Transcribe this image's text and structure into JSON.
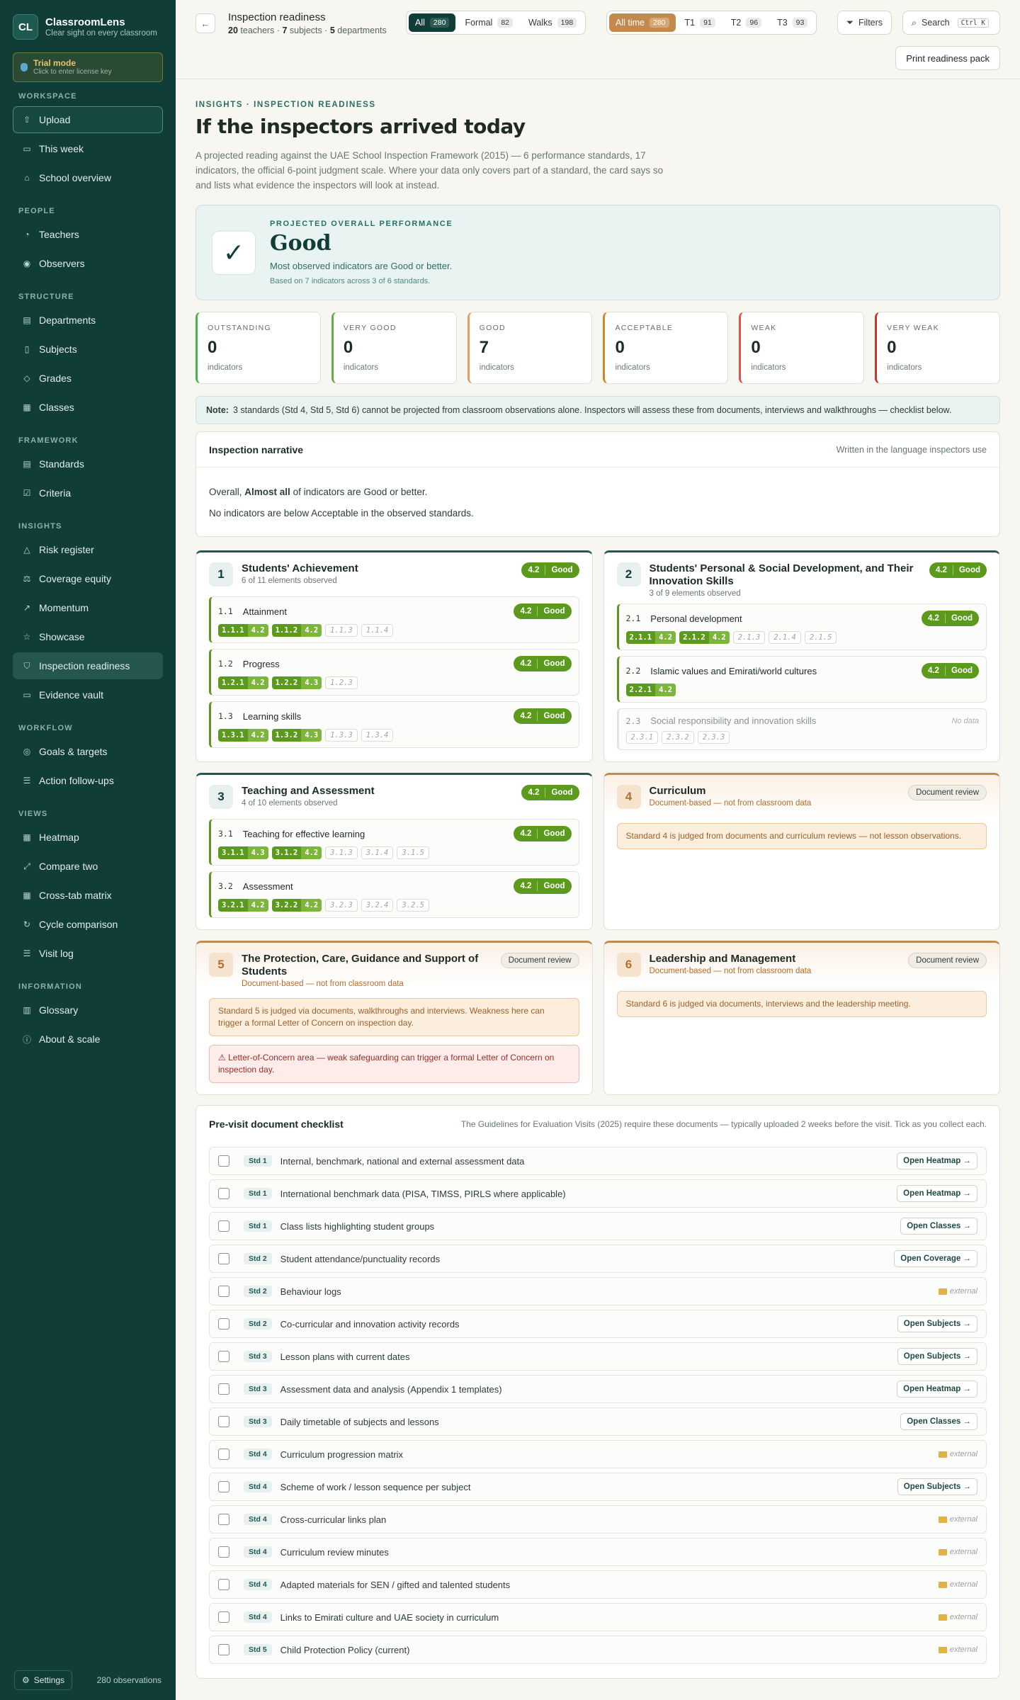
{
  "app": {
    "logo": "CL",
    "name": "ClassroomLens",
    "tagline": "Clear sight on every classroom"
  },
  "trial": {
    "title": "Trial mode",
    "subtitle": "Click to enter license key"
  },
  "sidebar": {
    "sections": [
      {
        "label": "WORKSPACE",
        "items": [
          {
            "label": "Upload",
            "icon": "upload-icon",
            "glyph": "⇧"
          },
          {
            "label": "This week",
            "icon": "calendar-icon",
            "glyph": "▭"
          },
          {
            "label": "School overview",
            "icon": "school-icon",
            "glyph": "⌂"
          }
        ]
      },
      {
        "label": "PEOPLE",
        "items": [
          {
            "label": "Teachers",
            "icon": "user-icon",
            "glyph": "◔"
          },
          {
            "label": "Observers",
            "icon": "eye-icon",
            "glyph": "◉"
          }
        ]
      },
      {
        "label": "STRUCTURE",
        "items": [
          {
            "label": "Departments",
            "icon": "layers-icon",
            "glyph": "▤"
          },
          {
            "label": "Subjects",
            "icon": "book-icon",
            "glyph": "▯"
          },
          {
            "label": "Grades",
            "icon": "graduation-cap-icon",
            "glyph": "◇"
          },
          {
            "label": "Classes",
            "icon": "grid-icon",
            "glyph": "▦"
          }
        ]
      },
      {
        "label": "FRAMEWORK",
        "items": [
          {
            "label": "Standards",
            "icon": "document-icon",
            "glyph": "▤"
          },
          {
            "label": "Criteria",
            "icon": "checklist-icon",
            "glyph": "☑"
          }
        ]
      },
      {
        "label": "INSIGHTS",
        "items": [
          {
            "label": "Risk register",
            "icon": "warning-icon",
            "glyph": "△"
          },
          {
            "label": "Coverage equity",
            "icon": "scale-icon",
            "glyph": "⚖"
          },
          {
            "label": "Momentum",
            "icon": "trend-icon",
            "glyph": "↗"
          },
          {
            "label": "Showcase",
            "icon": "star-icon",
            "glyph": "☆"
          },
          {
            "label": "Inspection readiness",
            "icon": "shield-icon",
            "glyph": "⛉"
          },
          {
            "label": "Evidence vault",
            "icon": "folder-icon",
            "glyph": "▭"
          }
        ]
      },
      {
        "label": "WORKFLOW",
        "items": [
          {
            "label": "Goals & targets",
            "icon": "target-icon",
            "glyph": "◎"
          },
          {
            "label": "Action follow-ups",
            "icon": "list-check-icon",
            "glyph": "☰"
          }
        ]
      },
      {
        "label": "VIEWS",
        "items": [
          {
            "label": "Heatmap",
            "icon": "heatmap-icon",
            "glyph": "▦"
          },
          {
            "label": "Compare two",
            "icon": "compare-icon",
            "glyph": "⤢"
          },
          {
            "label": "Cross-tab matrix",
            "icon": "table-icon",
            "glyph": "▦"
          },
          {
            "label": "Cycle comparison",
            "icon": "refresh-icon",
            "glyph": "↻"
          },
          {
            "label": "Visit log",
            "icon": "list-icon",
            "glyph": "☰"
          }
        ]
      },
      {
        "label": "INFORMATION",
        "items": [
          {
            "label": "Glossary",
            "icon": "book-open-icon",
            "glyph": "▥"
          },
          {
            "label": "About & scale",
            "icon": "info-icon",
            "glyph": "ⓘ"
          }
        ]
      }
    ],
    "active": "Inspection readiness",
    "footer": {
      "settings": "Settings",
      "observations": "280 observations"
    }
  },
  "header": {
    "title": "Inspection readiness",
    "teachers": "20",
    "teachers_label": "teachers",
    "subjects": "7",
    "subjects_label": "subjects",
    "departments": "5",
    "departments_label": "departments",
    "type_filter": [
      {
        "label": "All",
        "count": "280",
        "selected": true
      },
      {
        "label": "Formal",
        "count": "82"
      },
      {
        "label": "Walks",
        "count": "198"
      }
    ],
    "term_filter": [
      {
        "label": "All time",
        "count": "280",
        "selected": true
      },
      {
        "label": "T1",
        "count": "91"
      },
      {
        "label": "T2",
        "count": "96"
      },
      {
        "label": "T3",
        "count": "93"
      }
    ],
    "filters_label": "Filters",
    "search_label": "Search",
    "search_shortcut": "Ctrl K",
    "print_label": "Print readiness pack"
  },
  "intro": {
    "eyebrow": "INSIGHTS · INSPECTION READINESS",
    "title": "If the inspectors arrived today",
    "lead": "A projected reading against the UAE School Inspection Framework (2015) — 6 performance standards, 17 indicators, the official 6-point judgment scale. Where your data only covers part of a standard, the card says so and lists what evidence the inspectors will look at instead."
  },
  "overall": {
    "eyebrow": "PROJECTED OVERALL PERFORMANCE",
    "judgment": "Good",
    "description": "Most observed indicators are Good or better.",
    "basis": "Based on 7 indicators across 3 of 6 standards."
  },
  "distribution": [
    {
      "label": "OUTSTANDING",
      "count": "0",
      "unit": "indicators",
      "color": "#4caf50"
    },
    {
      "label": "VERY GOOD",
      "count": "0",
      "unit": "indicators",
      "color": "#6aa84f"
    },
    {
      "label": "GOOD",
      "count": "7",
      "unit": "indicators",
      "color": "#d9a36b"
    },
    {
      "label": "ACCEPTABLE",
      "count": "0",
      "unit": "indicators",
      "color": "#d9822b"
    },
    {
      "label": "WEAK",
      "count": "0",
      "unit": "indicators",
      "color": "#e0524a"
    },
    {
      "label": "VERY WEAK",
      "count": "0",
      "unit": "indicators",
      "color": "#c0392b"
    }
  ],
  "note": {
    "label": "Note:",
    "text": "3 standards (Std 4, Std 5, Std 6) cannot be projected from classroom observations alone. Inspectors will assess these from documents, interviews and walkthroughs — checklist below."
  },
  "narrative": {
    "title": "Inspection narrative",
    "caption": "Written in the language inspectors use",
    "line1_pre": "Overall,",
    "line1_bold": "Almost all",
    "line1_post": "of indicators are Good or better.",
    "line2": "No indicators are below Acceptable in the observed standards."
  },
  "standards_row1": [
    {
      "num": "1",
      "title": "Students' Achievement",
      "sub": "6 of 11 elements observed",
      "score": "4.2",
      "judgment": "Good",
      "indicators": [
        {
          "code": "1.1",
          "name": "Attainment",
          "score": "4.2",
          "judgment": "Good",
          "elements": [
            {
              "code": "1.1.1",
              "v": "4.2"
            },
            {
              "code": "1.1.2",
              "v": "4.2"
            },
            {
              "code": "1.1.3"
            },
            {
              "code": "1.1.4"
            }
          ]
        },
        {
          "code": "1.2",
          "name": "Progress",
          "score": "4.2",
          "judgment": "Good",
          "elements": [
            {
              "code": "1.2.1",
              "v": "4.2"
            },
            {
              "code": "1.2.2",
              "v": "4.3"
            },
            {
              "code": "1.2.3"
            }
          ]
        },
        {
          "code": "1.3",
          "name": "Learning skills",
          "score": "4.2",
          "judgment": "Good",
          "elements": [
            {
              "code": "1.3.1",
              "v": "4.2"
            },
            {
              "code": "1.3.2",
              "v": "4.3"
            },
            {
              "code": "1.3.3"
            },
            {
              "code": "1.3.4"
            }
          ]
        }
      ]
    },
    {
      "num": "2",
      "title": "Students' Personal & Social Development, and Their Innovation Skills",
      "sub": "3 of 9 elements observed",
      "score": "4.2",
      "judgment": "Good",
      "indicators": [
        {
          "code": "2.1",
          "name": "Personal development",
          "score": "4.2",
          "judgment": "Good",
          "elements": [
            {
              "code": "2.1.1",
              "v": "4.2"
            },
            {
              "code": "2.1.2",
              "v": "4.2"
            },
            {
              "code": "2.1.3"
            },
            {
              "code": "2.1.4"
            },
            {
              "code": "2.1.5"
            }
          ]
        },
        {
          "code": "2.2",
          "name": "Islamic values and Emirati/world cultures",
          "score": "4.2",
          "judgment": "Good",
          "elements": [
            {
              "code": "2.2.1",
              "v": "4.2"
            }
          ]
        },
        {
          "code": "2.3",
          "name": "Social responsibility and innovation skills",
          "nodata": "No data",
          "elements": [
            {
              "code": "2.3.1"
            },
            {
              "code": "2.3.2"
            },
            {
              "code": "2.3.3"
            }
          ]
        }
      ]
    }
  ],
  "standards_row2_obs": {
    "num": "3",
    "title": "Teaching and Assessment",
    "sub": "4 of 10 elements observed",
    "score": "4.2",
    "judgment": "Good",
    "indicators": [
      {
        "code": "3.1",
        "name": "Teaching for effective learning",
        "score": "4.2",
        "judgment": "Good",
        "elements": [
          {
            "code": "3.1.1",
            "v": "4.3"
          },
          {
            "code": "3.1.2",
            "v": "4.2"
          },
          {
            "code": "3.1.3"
          },
          {
            "code": "3.1.4"
          },
          {
            "code": "3.1.5"
          }
        ]
      },
      {
        "code": "3.2",
        "name": "Assessment",
        "score": "4.2",
        "judgment": "Good",
        "elements": [
          {
            "code": "3.2.1",
            "v": "4.2"
          },
          {
            "code": "3.2.2",
            "v": "4.2"
          },
          {
            "code": "3.2.3"
          },
          {
            "code": "3.2.4"
          },
          {
            "code": "3.2.5"
          }
        ]
      }
    ]
  },
  "standards_doc": [
    {
      "num": "4",
      "title": "Curriculum",
      "sub": "Document-based — not from classroom data",
      "badge": "Document review",
      "note": "Standard 4 is judged from documents and curriculum reviews — not lesson observations."
    },
    {
      "num": "5",
      "title": "The Protection, Care, Guidance and Support of Students",
      "sub": "Document-based — not from classroom data",
      "badge": "Document review",
      "note": "Standard 5 is judged via documents, walkthroughs and interviews. Weakness here can trigger a formal Letter of Concern on inspection day.",
      "warning": "Letter-of-Concern area — weak safeguarding can trigger a formal Letter of Concern on inspection day."
    },
    {
      "num": "6",
      "title": "Leadership and Management",
      "sub": "Document-based — not from classroom data",
      "badge": "Document review",
      "note": "Standard 6 is judged via documents, interviews and the leadership meeting."
    }
  ],
  "checklist": {
    "title": "Pre-visit document checklist",
    "caption": "The Guidelines for Evaluation Visits (2025) require these documents — typically uploaded 2 weeks before the visit. Tick as you collect each.",
    "external_label": "external",
    "items": [
      {
        "std": "Std 1",
        "text": "Internal, benchmark, national and external assessment data",
        "action": "Open Heatmap →"
      },
      {
        "std": "Std 1",
        "text": "International benchmark data (PISA, TIMSS, PIRLS where applicable)",
        "action": "Open Heatmap →"
      },
      {
        "std": "Std 1",
        "text": "Class lists highlighting student groups",
        "action": "Open Classes →"
      },
      {
        "std": "Std 2",
        "text": "Student attendance/punctuality records",
        "action": "Open Coverage →"
      },
      {
        "std": "Std 2",
        "text": "Behaviour logs",
        "external": true
      },
      {
        "std": "Std 2",
        "text": "Co-curricular and innovation activity records",
        "action": "Open Subjects →"
      },
      {
        "std": "Std 3",
        "text": "Lesson plans with current dates",
        "action": "Open Subjects →"
      },
      {
        "std": "Std 3",
        "text": "Assessment data and analysis (Appendix 1 templates)",
        "action": "Open Heatmap →"
      },
      {
        "std": "Std 3",
        "text": "Daily timetable of subjects and lessons",
        "action": "Open Classes →"
      },
      {
        "std": "Std 4",
        "text": "Curriculum progression matrix",
        "external": true
      },
      {
        "std": "Std 4",
        "text": "Scheme of work / lesson sequence per subject",
        "action": "Open Subjects →"
      },
      {
        "std": "Std 4",
        "text": "Cross-curricular links plan",
        "external": true
      },
      {
        "std": "Std 4",
        "text": "Curriculum review minutes",
        "external": true
      },
      {
        "std": "Std 4",
        "text": "Adapted materials for SEN / gifted and talented students",
        "external": true
      },
      {
        "std": "Std 4",
        "text": "Links to Emirati culture and UAE society in curriculum",
        "external": true
      },
      {
        "std": "Std 5",
        "text": "Child Protection Policy (current)",
        "external": true
      }
    ]
  }
}
